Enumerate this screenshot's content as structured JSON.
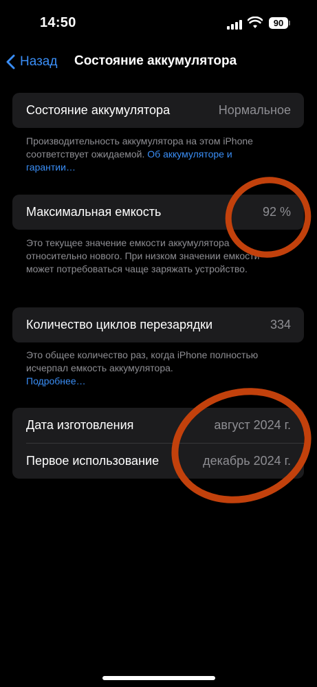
{
  "status_bar": {
    "time": "14:50",
    "battery_level": "90",
    "icons": [
      "signal-icon",
      "wifi-icon",
      "battery-icon"
    ]
  },
  "nav": {
    "back_label": "Назад",
    "title": "Состояние аккумулятора"
  },
  "health": {
    "label": "Состояние аккумулятора",
    "value": "Нормальное",
    "note": "Производительность аккумулятора на этом iPhone соответствует ожидаемой. ",
    "note_link": "Об аккумуляторе и гарантии…"
  },
  "capacity": {
    "label": "Максимальная емкость",
    "value": "92 %",
    "note": "Это текущее значение емкости аккумулятора относительно нового. При низком значении емкости может потребоваться чаще заряжать устройство."
  },
  "cycles": {
    "label": "Количество циклов перезарядки",
    "value": "334",
    "note": "Это общее количество раз, когда iPhone полностью исчерпал емкость аккумулятора.",
    "note_link": "Подробнее…"
  },
  "dates": {
    "manufacture_label": "Дата изготовления",
    "manufacture_value": "август 2024 г.",
    "first_use_label": "Первое использование",
    "first_use_value": "декабрь 2024 г."
  },
  "colors": {
    "accent": "#3a8ef6",
    "annotation": "#c2410c",
    "cell": "#1c1c1e",
    "secondary_text": "#8e8e93"
  }
}
